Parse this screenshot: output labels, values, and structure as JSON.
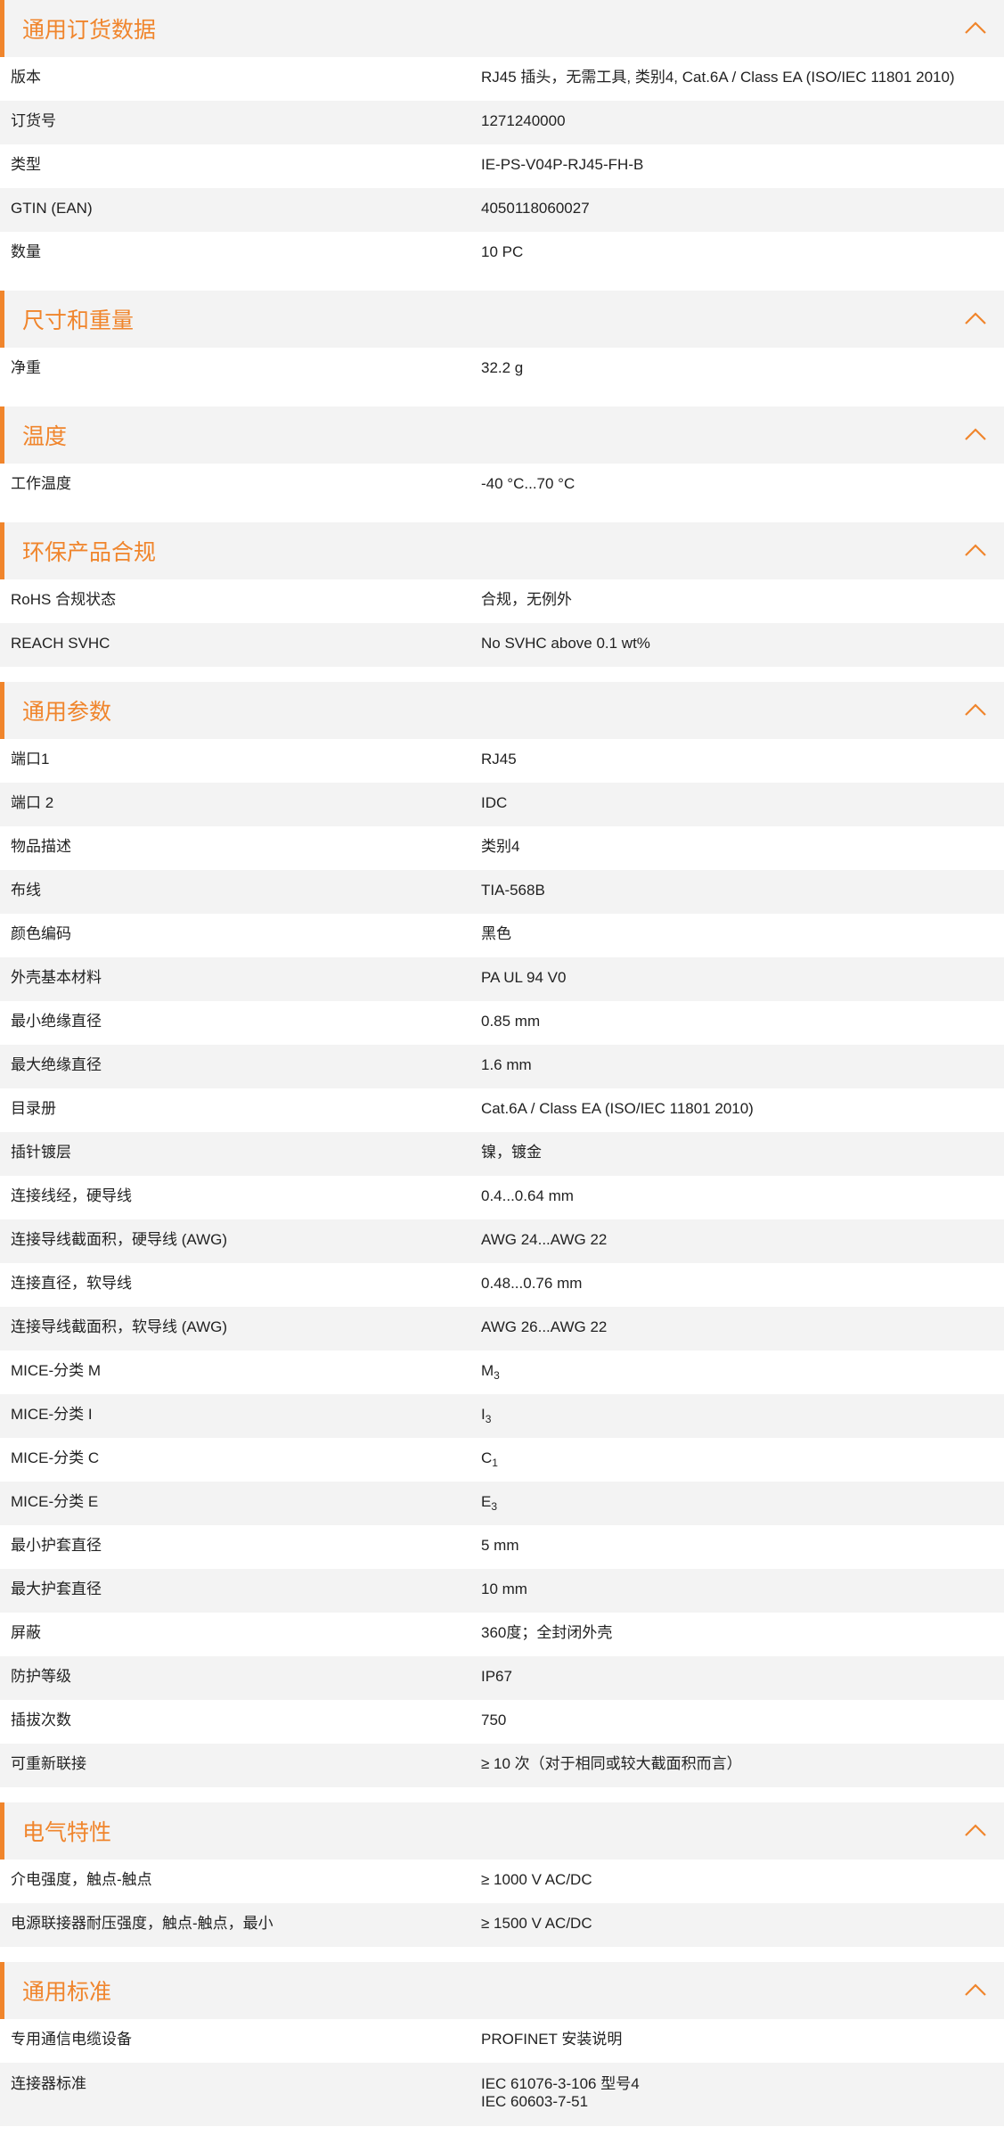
{
  "accent_color": "#f0852c",
  "chevron_icon": "chevron-up-icon",
  "sections": [
    {
      "title": "通用订货数据",
      "rows": [
        {
          "label": "版本",
          "value": "RJ45 插头，无需工具, 类别4, Cat.6A / Class EA (ISO/IEC 11801 2010)"
        },
        {
          "label": "订货号",
          "value": "1271240000"
        },
        {
          "label": "类型",
          "value": "IE-PS-V04P-RJ45-FH-B"
        },
        {
          "label": "GTIN (EAN)",
          "value": "4050118060027"
        },
        {
          "label": "数量",
          "value": "10  PC"
        }
      ]
    },
    {
      "title": "尺寸和重量",
      "rows": [
        {
          "label": "净重",
          "value": "32.2  g"
        }
      ]
    },
    {
      "title": "温度",
      "rows": [
        {
          "label": "工作温度",
          "value": "-40 °C...70 °C"
        }
      ]
    },
    {
      "title": "环保产品合规",
      "rows": [
        {
          "label": "RoHS 合规状态",
          "value": "合规，无例外"
        },
        {
          "label": "REACH SVHC",
          "value": "No SVHC above 0.1 wt%"
        }
      ]
    },
    {
      "title": "通用参数",
      "rows": [
        {
          "label": "端口1",
          "value": "RJ45"
        },
        {
          "label": "端口 2",
          "value": "IDC"
        },
        {
          "label": "物品描述",
          "value": "类别4"
        },
        {
          "label": "布线",
          "value": "TIA-568B"
        },
        {
          "label": "颜色编码",
          "value": "黑色"
        },
        {
          "label": "外壳基本材料",
          "value": "PA UL 94 V0"
        },
        {
          "label": "最小绝缘直径",
          "value": "0.85  mm"
        },
        {
          "label": "最大绝缘直径",
          "value": "1.6  mm"
        },
        {
          "label": "目录册",
          "value": "Cat.6A / Class EA (ISO/IEC 11801 2010)"
        },
        {
          "label": "插针镀层",
          "value": "镍，镀金"
        },
        {
          "label": "连接线经，硬导线",
          "value": "0.4...0.64 mm"
        },
        {
          "label": "连接导线截面积，硬导线 (AWG)",
          "value": "AWG 24...AWG 22"
        },
        {
          "label": "连接直径，软导线",
          "value": "0.48...0.76 mm"
        },
        {
          "label": "连接导线截面积，软导线 (AWG)",
          "value": "AWG 26...AWG 22"
        },
        {
          "label": "MICE-分类 M",
          "value": "M",
          "sub": "3"
        },
        {
          "label": "MICE-分类 I",
          "value": "I",
          "sub": "3"
        },
        {
          "label": "MICE-分类 C",
          "value": "C",
          "sub": "1"
        },
        {
          "label": "MICE-分类 E",
          "value": "E",
          "sub": "3"
        },
        {
          "label": "最小护套直径",
          "value": "5  mm"
        },
        {
          "label": "最大护套直径",
          "value": "10  mm"
        },
        {
          "label": "屏蔽",
          "value": "360度；全封闭外壳"
        },
        {
          "label": "防护等级",
          "value": "IP67"
        },
        {
          "label": "插拔次数",
          "value": "750"
        },
        {
          "label": "可重新联接",
          "value": "≥ 10 次（对于相同或较大截面积而言）"
        }
      ]
    },
    {
      "title": "电气特性",
      "rows": [
        {
          "label": "介电强度，触点-触点",
          "value": "≥ 1000 V AC/DC"
        },
        {
          "label": "电源联接器耐压强度，触点-触点，最小",
          "value": "≥ 1500 V AC/DC"
        }
      ]
    },
    {
      "title": "通用标准",
      "rows": [
        {
          "label": "专用通信电缆设备",
          "value": "PROFINET 安装说明"
        },
        {
          "label": "连接器标准",
          "value": "IEC 61076-3-106 型号4\nIEC 60603-7-51"
        }
      ]
    }
  ]
}
